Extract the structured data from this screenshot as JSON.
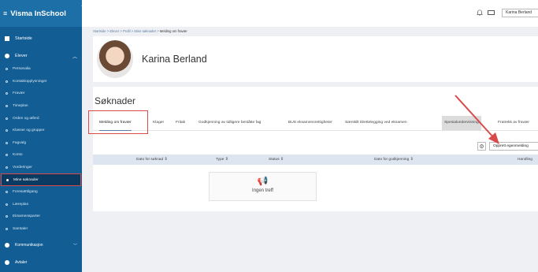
{
  "app": {
    "title": "Visma InSchool"
  },
  "sidebar": {
    "home": "Startside",
    "section": "Elever",
    "items": [
      "Personalia",
      "Kontaktopplysninger",
      "Fravær",
      "Timeplan",
      "Orden og atferd",
      "Klasser og grupper",
      "Fagvalg",
      "Konto",
      "Vurderinger",
      "Mine søknader",
      "Foresatttilgang",
      "Læreplan",
      "Eksamensparter",
      "Samtaler"
    ],
    "active_index": 9,
    "communication": "Kommunikasjon",
    "calendar": "Avtaler"
  },
  "topbar": {
    "user_name": "Karina Berland"
  },
  "breadcrumb": {
    "parts": [
      "Startside",
      "Elever",
      "Profil",
      "Mine søknader"
    ],
    "current": "Melding om fravær",
    "separator": ">"
  },
  "profile": {
    "name": "Karina Berland"
  },
  "applications": {
    "title": "Søknader",
    "tabs": [
      "Melding om fravær",
      "Klager",
      "Fritak",
      "Godkjenning av tidligere beståtte fag",
      "BUS eksamensrettigheter",
      "Særskilt tilrettelegging ved eksamen",
      "Spesialundervisning",
      "Fratrekk av fravær"
    ],
    "create_button": "Opprett egenmelding",
    "columns": [
      "Dato for søknad",
      "Type",
      "Status",
      "Dato for godkjenning",
      "Handling"
    ],
    "empty_text": "Ingen treff"
  },
  "colors": {
    "sidebar": "#115d94",
    "active_item": "#0b3b63",
    "highlight": "#d94a4a",
    "empty_icon": "#e8a520"
  }
}
